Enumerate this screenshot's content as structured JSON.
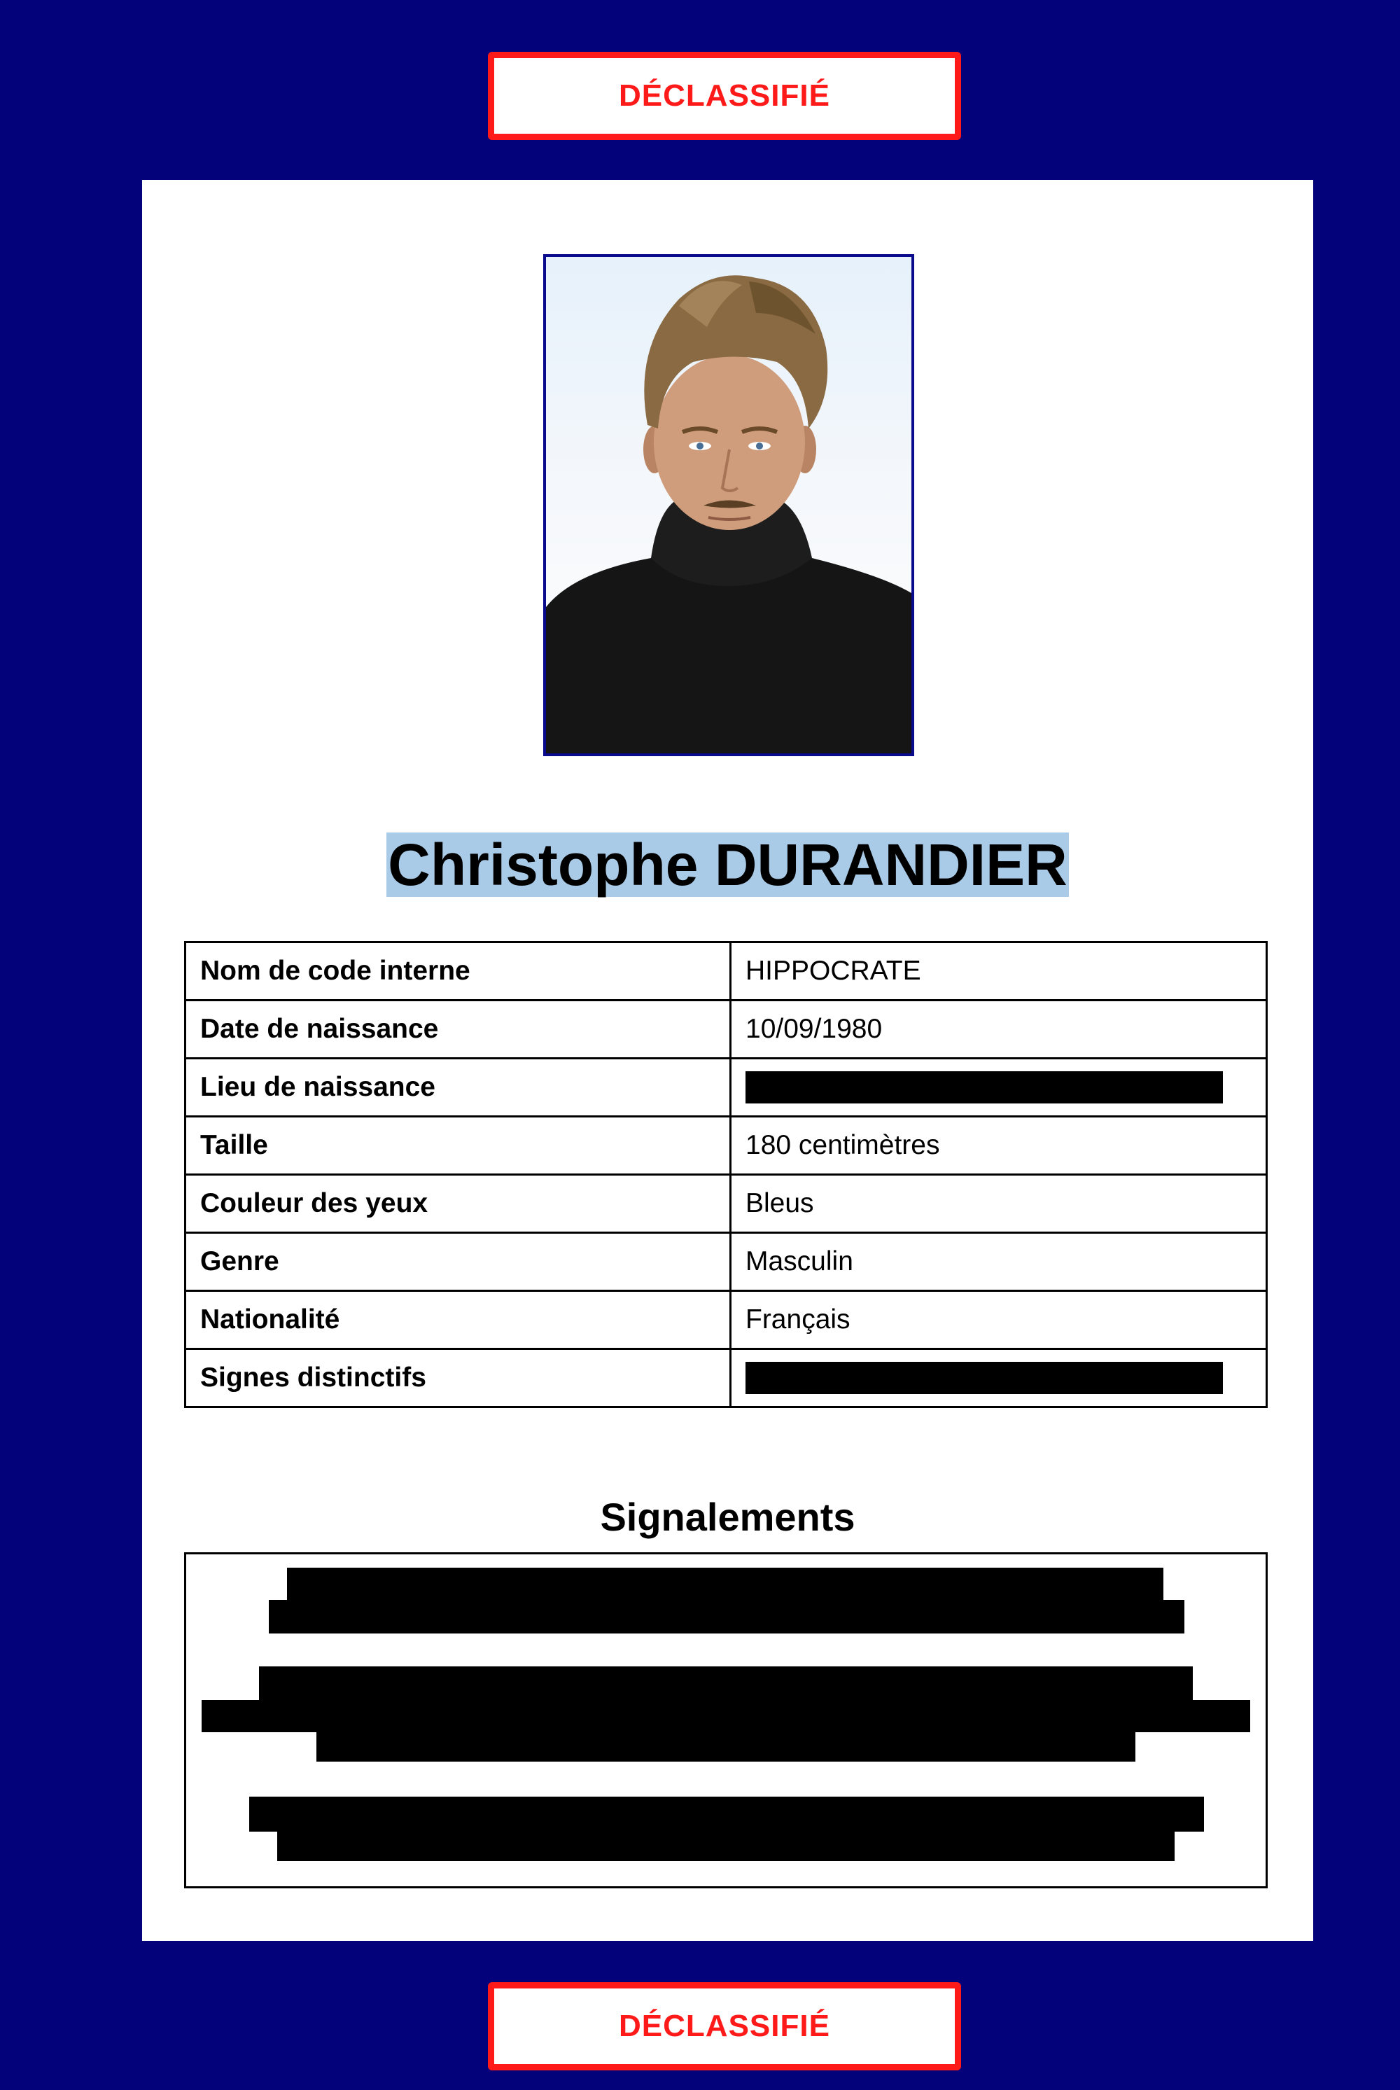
{
  "stamp_top": "DÉCLASSIFIÉ",
  "stamp_bottom": "DÉCLASSIFIÉ",
  "person": {
    "name": "Christophe DURANDIER"
  },
  "info_rows": [
    {
      "label": "Nom de code interne",
      "value": "HIPPOCRATE",
      "redacted": false
    },
    {
      "label": "Date de naissance",
      "value": "10/09/1980",
      "redacted": false
    },
    {
      "label": "Lieu de naissance",
      "value": "",
      "redacted": true
    },
    {
      "label": "Taille",
      "value": "180 centimètres",
      "redacted": false
    },
    {
      "label": "Couleur des yeux",
      "value": "Bleus",
      "redacted": false
    },
    {
      "label": "Genre",
      "value": "Masculin",
      "redacted": false
    },
    {
      "label": "Nationalité",
      "value": "Français",
      "redacted": false
    },
    {
      "label": "Signes distinctifs",
      "value": "",
      "redacted": true
    }
  ],
  "signalements": {
    "title": "Signalements",
    "redacted": true
  },
  "colors": {
    "background": "#04027a",
    "stamp": "#ff1a1a",
    "highlight": "#a9cbe8",
    "redaction": "#000000"
  }
}
